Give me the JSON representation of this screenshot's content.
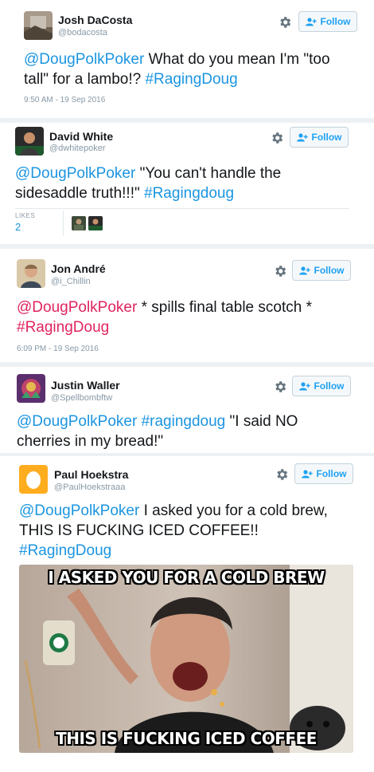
{
  "tweets": [
    {
      "name": "Josh DaCosta",
      "handle": "@bodacosta",
      "follow_label": "Follow",
      "mention": "@DougPolkPoker",
      "body": " What do you mean I'm \"too tall\" for a lambo!? ",
      "hashtag": "#RagingDoug",
      "timestamp": "9:50 AM - 19 Sep 2016"
    },
    {
      "name": "David White",
      "handle": "@dwhitepoker",
      "follow_label": "Follow",
      "mention": "@DougPolkPoker",
      "body": " \"You can't handle the sidesaddle truth!!!\" ",
      "hashtag": "#Ragingdoug",
      "likes_label": "LIKES",
      "likes_count": "2"
    },
    {
      "name": "Jon André",
      "handle": "@i_Chillin",
      "follow_label": "Follow",
      "mention": "@DougPolkPoker",
      "body": " * spills final table scotch * ",
      "hashtag": "#RagingDoug",
      "timestamp": "6:09 PM - 19 Sep 2016"
    },
    {
      "name": "Justin Waller",
      "handle": "@Spellbombftw",
      "follow_label": "Follow",
      "mention": "@DougPolkPoker",
      "hashtag": "#ragingdoug",
      "body": " \"I said NO cherries in my bread!\""
    },
    {
      "name": "Paul Hoekstra",
      "handle": "@PaulHoekstraaa",
      "follow_label": "Follow",
      "mention": "@DougPolkPoker",
      "body": " I asked you for a cold brew, THIS IS FUCKING ICED COFFEE!! ",
      "hashtag": "#RagingDoug",
      "meme_top": "I ASKED YOU FOR A COLD BREW",
      "meme_bottom": "THIS IS FUCKING ICED COFFEE"
    }
  ],
  "colors": {
    "link": "#1b95e0",
    "mention_red": "#e0245e",
    "follow_border": "#c5d2db",
    "muted": "#8899a6"
  },
  "icons": [
    "gear-icon",
    "follow-user-icon",
    "avatar"
  ]
}
